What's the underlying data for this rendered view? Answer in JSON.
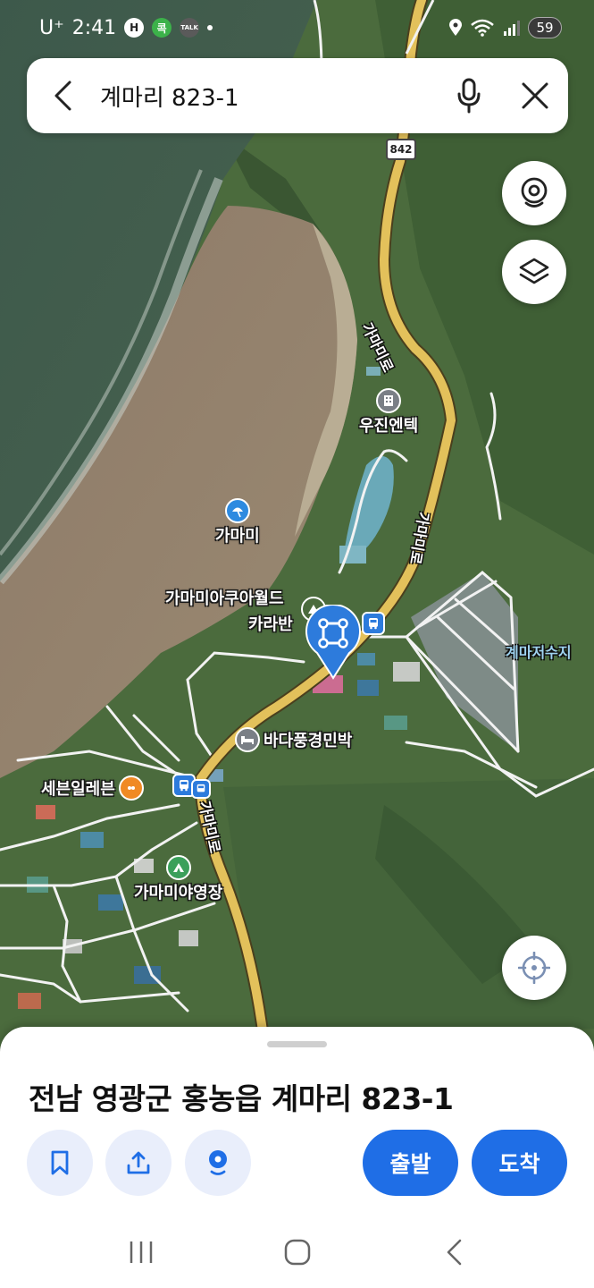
{
  "status_bar": {
    "carrier": "U⁺",
    "time": "2:41",
    "badge_h": "H",
    "badge_k": "콕",
    "badge_talk": "TALK",
    "battery": "59"
  },
  "search": {
    "query": "계마리 823-1"
  },
  "map": {
    "route_number": "842",
    "road_labels": [
      "가마미로",
      "가마미로",
      "가마미로"
    ],
    "reservoir_label": "계마저수지",
    "pois": {
      "woojin": "우진엔텍",
      "gamami_beach": "가마미",
      "aquaworld": "가마미아쿠아월드",
      "karaban": "카라반",
      "minbak": "바다풍경민박",
      "seven_eleven": "세븐일레븐",
      "campground": "가마미야영장"
    },
    "colors": {
      "road_main": "#e3c15b",
      "road_minor": "#f2f2f2",
      "sea": "#3f5a4c",
      "beach": "#8c7866",
      "land": "#4a6a3c",
      "accent_blue": "#2d7bdc"
    }
  },
  "sheet": {
    "address": "전남 영광군 홍농읍 계마리 823-1",
    "depart_label": "출발",
    "arrive_label": "도착",
    "accent": "#1f6ee6"
  }
}
